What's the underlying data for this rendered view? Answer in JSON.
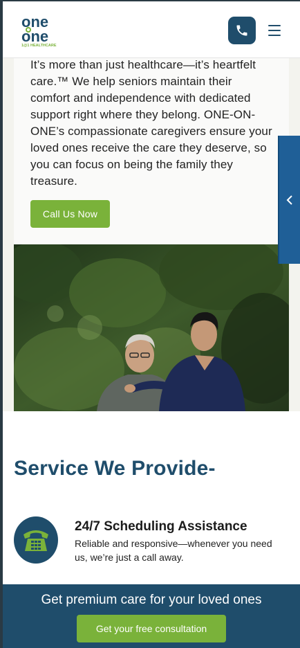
{
  "header": {
    "logo_line1": "one",
    "logo_line2": "one",
    "logo_tagline": "1@1 HEALTHCARE",
    "phone_icon": "phone-icon",
    "menu_icon": "hamburger-menu-icon"
  },
  "hero": {
    "paragraph": "It’s more than just healthcare—it’s heartfelt care.™ We help seniors maintain their comfort and independence with dedicated support right where they belong. ONE-ON-ONE’s compassionate caregivers ensure your loved ones receive the care they deserve, so you can focus on being the family they treasure.",
    "cta_label": "Call Us Now",
    "photo_icon": "caregiver-photo"
  },
  "side_tab": {
    "icon": "chevron-left-icon"
  },
  "services": {
    "title": "Service We Provide-",
    "items": [
      {
        "icon": "telephone-icon",
        "title": "24/7 Scheduling Assistance",
        "description": "Reliable and responsive—whenever you need us, we’re just a call away."
      }
    ]
  },
  "bottom_bar": {
    "text": "Get premium care for your loved ones",
    "button_label": "Get your free consultation"
  },
  "colors": {
    "brand_navy": "#1f4d6b",
    "brand_green": "#7ab23a",
    "side_tab_blue": "#1f5f97"
  }
}
